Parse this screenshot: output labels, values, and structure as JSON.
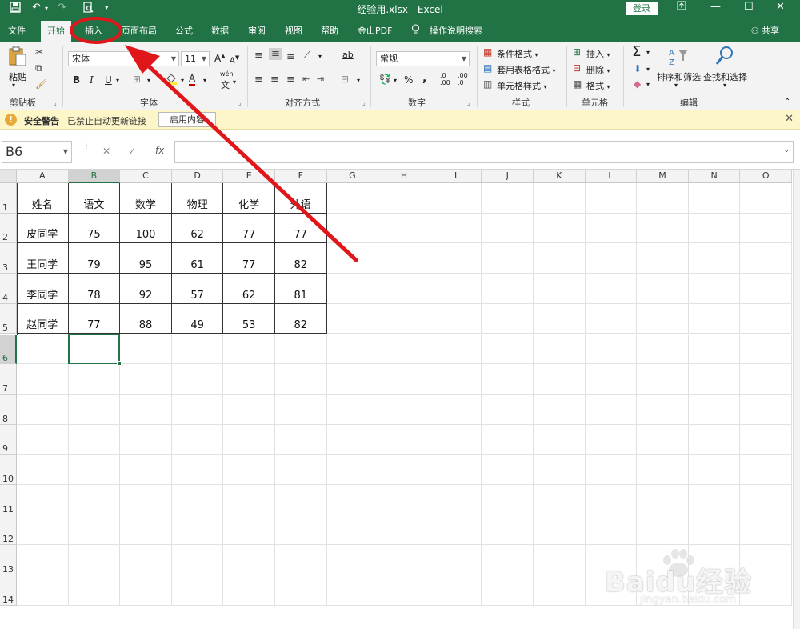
{
  "titlebar": {
    "title": "经验用.xlsx  -  Excel",
    "login": "登录",
    "icons": [
      "save-icon",
      "undo-icon",
      "redo-icon",
      "print-preview-icon",
      "customize-icon"
    ],
    "window_icons": [
      "ribbon-display-icon",
      "minimize-icon",
      "maximize-icon",
      "close-icon"
    ]
  },
  "tabs": [
    {
      "label": "文件"
    },
    {
      "label": "开始"
    },
    {
      "label": "插入"
    },
    {
      "label": "页面布局"
    },
    {
      "label": "公式"
    },
    {
      "label": "数据"
    },
    {
      "label": "审阅"
    },
    {
      "label": "视图"
    },
    {
      "label": "帮助"
    },
    {
      "label": "金山PDF"
    },
    {
      "label": "操作说明搜索"
    }
  ],
  "share": "共享",
  "ribbon": {
    "clipboard": {
      "paste": "粘贴",
      "label": "剪贴板"
    },
    "font": {
      "name": "宋体",
      "size": "11",
      "label": "字体",
      "grow": "A",
      "shrink": "A",
      "bold": "B",
      "italic": "I",
      "underline": "U",
      "font_color": "A",
      "phonetic": "wén",
      "accent": "#c00000"
    },
    "alignment": {
      "label": "对齐方式",
      "wrap": "ab"
    },
    "number": {
      "format": "常规",
      "label": "数字",
      "percent": "%",
      "comma": ","
    },
    "styles": {
      "conditional": "条件格式",
      "table": "套用表格格式",
      "cell_styles": "单元格样式",
      "label": "样式"
    },
    "cells": {
      "insert": "插入",
      "delete": "删除",
      "format": "格式",
      "label": "单元格"
    },
    "editing": {
      "sort": "排序和筛选",
      "find": "查找和选择",
      "label": "编辑",
      "sum": "Σ"
    }
  },
  "security": {
    "title": "安全警告",
    "message": "已禁止自动更新链接",
    "button": "启用内容"
  },
  "formula": {
    "name_box": "B6",
    "fx": "fx",
    "value": ""
  },
  "sheet": {
    "columns": [
      "A",
      "B",
      "C",
      "D",
      "E",
      "F",
      "G",
      "H",
      "I",
      "J",
      "K",
      "L",
      "M",
      "N",
      "O"
    ],
    "rows": [
      "1",
      "2",
      "3",
      "4",
      "5",
      "6",
      "7",
      "8",
      "9",
      "10",
      "11",
      "12",
      "13",
      "14"
    ],
    "selected_column": "B",
    "selected_row": "6",
    "table": [
      [
        "姓名",
        "语文",
        "数学",
        "物理",
        "化学",
        "外语"
      ],
      [
        "皮同学",
        "75",
        "100",
        "62",
        "77",
        "77"
      ],
      [
        "王同学",
        "79",
        "95",
        "61",
        "77",
        "82"
      ],
      [
        "李同学",
        "78",
        "92",
        "57",
        "62",
        "81"
      ],
      [
        "赵同学",
        "77",
        "88",
        "49",
        "53",
        "82"
      ]
    ]
  },
  "annotation": {
    "color": "#e0161b",
    "target": "插入"
  },
  "watermark": {
    "main": "Baidu经验",
    "sub": "jingyan.baidu.com"
  },
  "theme": {
    "excel_green": "#217346"
  }
}
